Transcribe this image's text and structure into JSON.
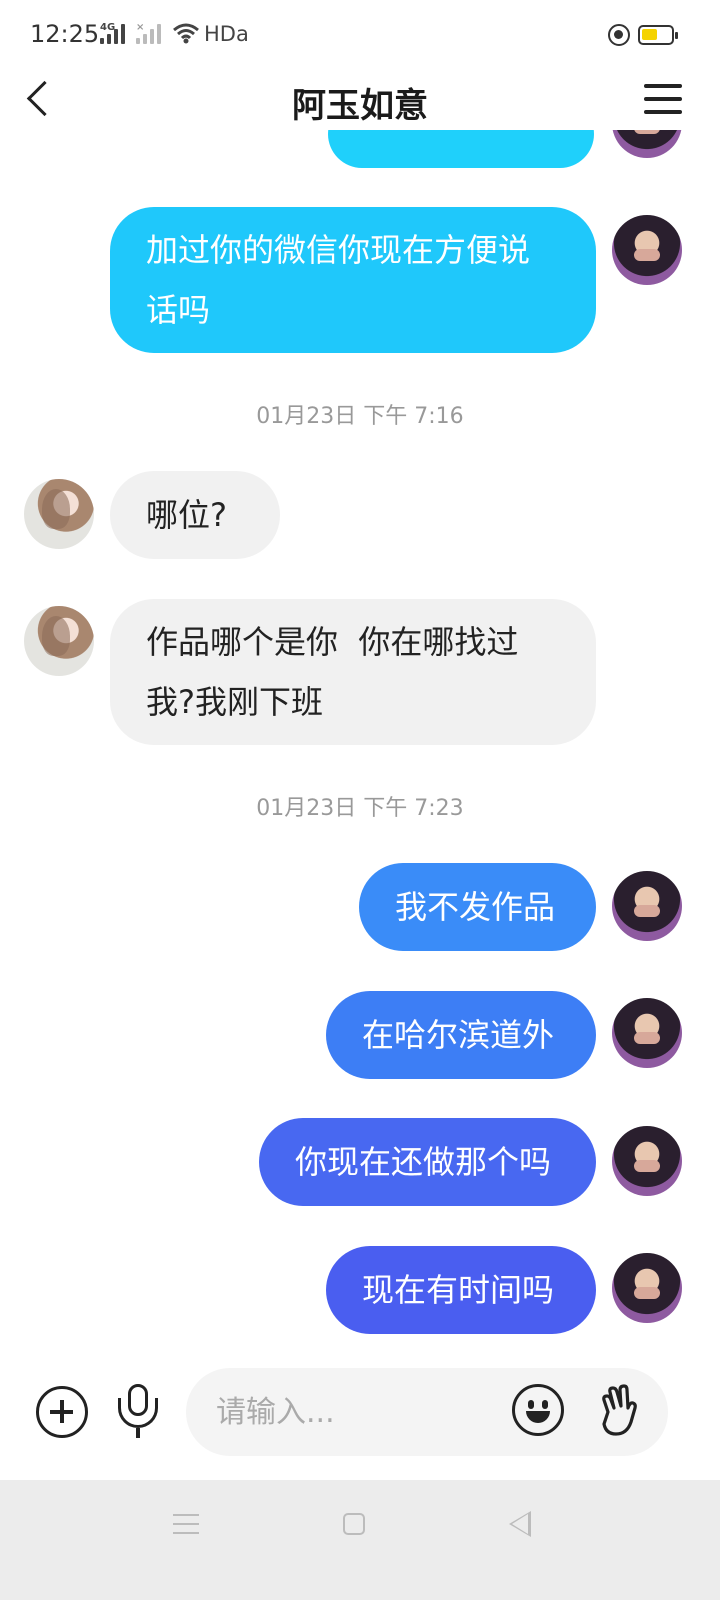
{
  "status_bar": {
    "time": "12:25",
    "network_tag": "4G",
    "network_tag_2": "×",
    "hd_label": "HDa"
  },
  "header": {
    "title": "阿玉如意"
  },
  "messages": [
    {
      "type": "sent",
      "text": ""
    },
    {
      "type": "sent",
      "lines": [
        "加过你的微信你现在方便说",
        "话吗"
      ]
    },
    {
      "type": "timestamp",
      "text": "01月23日 下午 7:16"
    },
    {
      "type": "received",
      "text": "哪位?"
    },
    {
      "type": "received",
      "lines": [
        "作品哪个是你  你在哪找过",
        "我?我刚下班"
      ]
    },
    {
      "type": "timestamp",
      "text": "01月23日 下午 7:23"
    },
    {
      "type": "sent",
      "text": "我不发作品"
    },
    {
      "type": "sent",
      "text": "在哈尔滨道外"
    },
    {
      "type": "sent",
      "text": "你现在还做那个吗"
    },
    {
      "type": "sent",
      "text": "现在有时间吗"
    }
  ],
  "input": {
    "placeholder": "请输入..."
  },
  "colors": {
    "bubble_cyan": "#1fd0fb",
    "bubble_blue": "#3a8cf8",
    "bubble_violet": "#4a5ef0",
    "received_bg": "#f1f1f1"
  },
  "icons": [
    "back-icon",
    "menu-icon",
    "plus-icon",
    "mic-icon",
    "emoji-icon",
    "wave-hand-icon"
  ]
}
